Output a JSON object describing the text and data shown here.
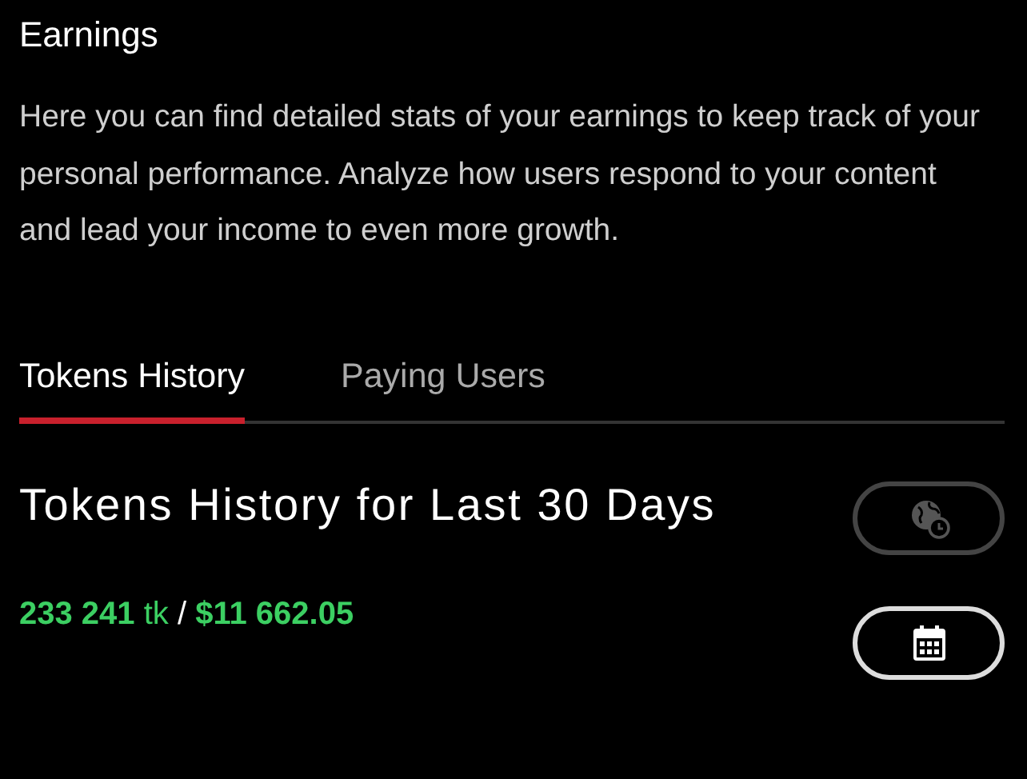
{
  "title": "Earnings",
  "description": "Here you can find detailed stats of your earnings to keep track of your personal performance. Analyze how users respond to your content and lead your income to even more growth.",
  "tabs": [
    {
      "label": "Tokens History",
      "selected": true
    },
    {
      "label": "Paying Users",
      "selected": false
    }
  ],
  "section_title": "Tokens History for Last 30 Days",
  "summary": {
    "tokens": "233 241",
    "unit": "tk",
    "separator": "/",
    "amount": "$11 662.05"
  },
  "buttons": [
    {
      "kind": "timezone",
      "disabled": true
    },
    {
      "kind": "calendar",
      "disabled": false
    }
  ]
}
